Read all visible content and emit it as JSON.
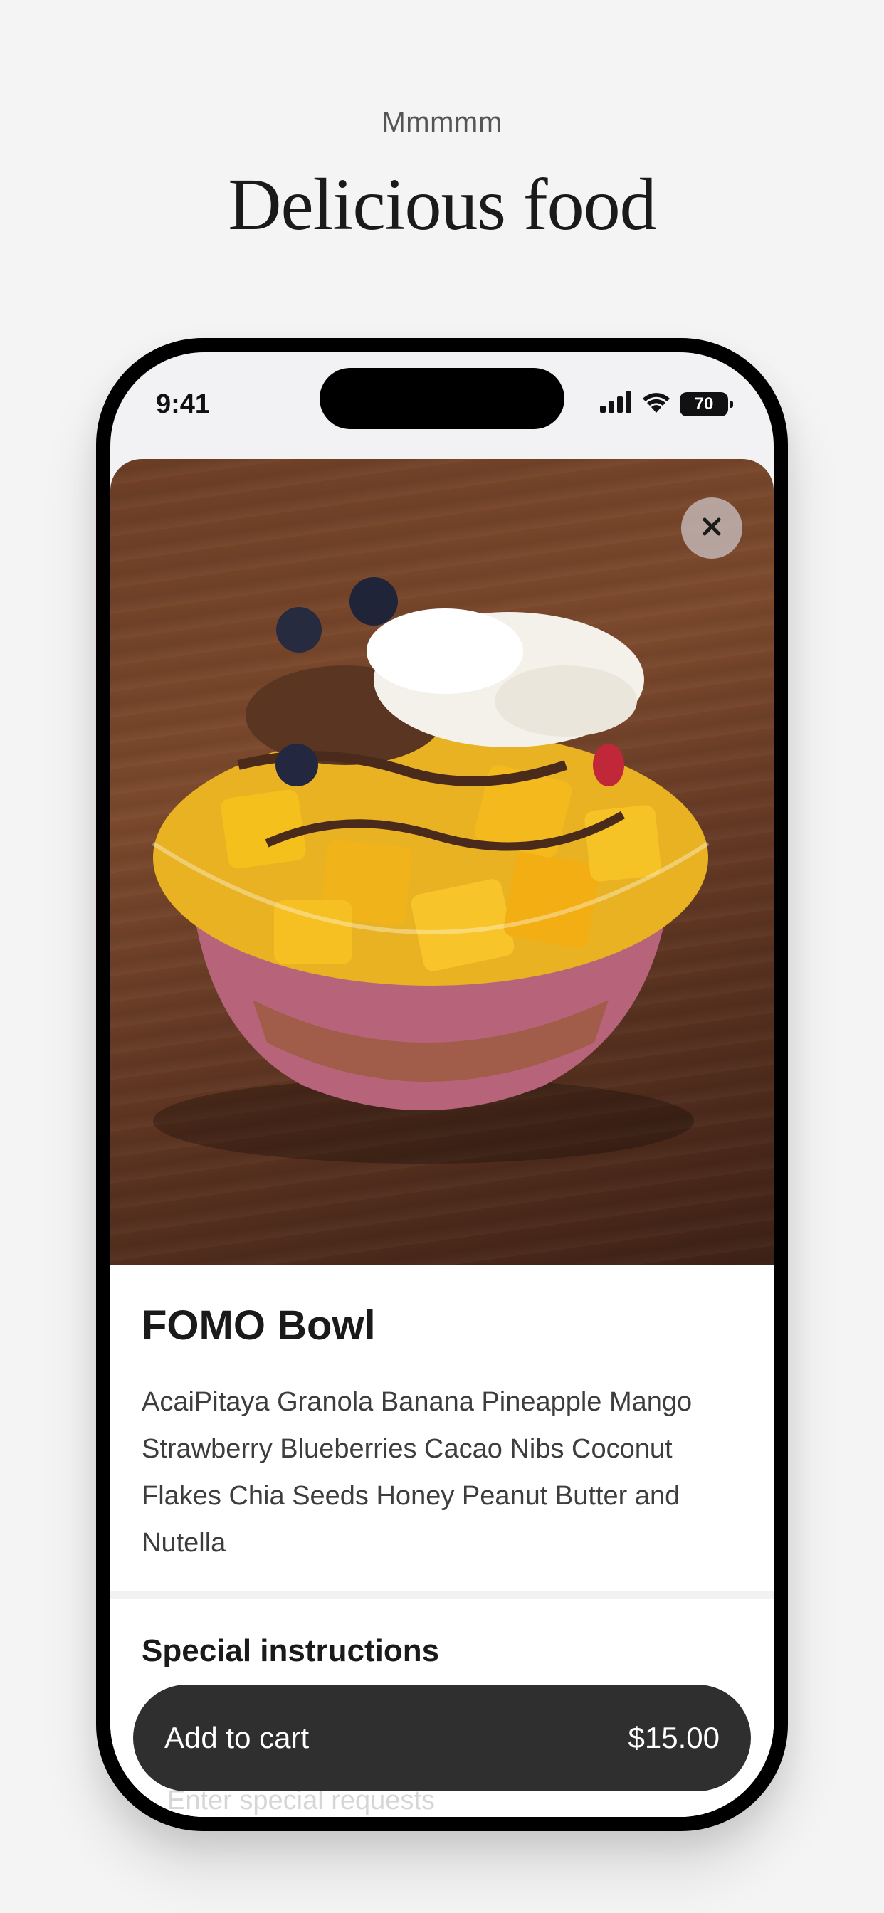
{
  "header": {
    "eyebrow": "Mmmmm",
    "headline": "Delicious food"
  },
  "status_bar": {
    "time": "9:41",
    "battery": "70"
  },
  "item": {
    "image_alt": "Acai bowl topped with mango, pineapple, coconut flakes, blueberries and chocolate drizzle on a wooden table",
    "name": "FOMO Bowl",
    "description": "AcaiPitaya Granola Banana Pineapple Mango Strawberry Blueberries Cacao Nibs Coconut Flakes Chia Seeds Honey Peanut Butter and Nutella"
  },
  "special_instructions": {
    "title": "Special instructions",
    "placeholder": "Enter special requests"
  },
  "cart_button": {
    "label": "Add to cart",
    "price": "$15.00"
  },
  "icons": {
    "close": "close-icon",
    "signal": "cellular-signal-icon",
    "wifi": "wifi-icon",
    "battery": "battery-icon"
  },
  "colors": {
    "background": "#f4f4f4",
    "cart_button": "#2f2f2f",
    "text_primary": "#1a1a1a"
  }
}
